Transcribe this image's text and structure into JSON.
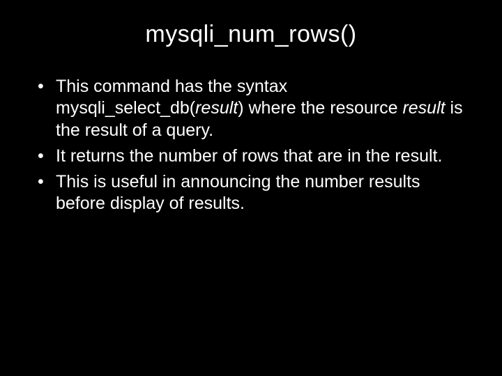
{
  "title": "mysqli_num_rows()",
  "bullets": [
    {
      "pre": "This command has the syntax mysqli_select_db(",
      "arg": "result",
      "mid": ") where the resource ",
      "arg2": "result",
      "post": " is the result of a query."
    },
    {
      "pre": "It returns the number of rows that are in the result.",
      "arg": "",
      "mid": "",
      "arg2": "",
      "post": ""
    },
    {
      "pre": "This is useful in announcing the number results before display of results.",
      "arg": "",
      "mid": "",
      "arg2": "",
      "post": ""
    }
  ]
}
